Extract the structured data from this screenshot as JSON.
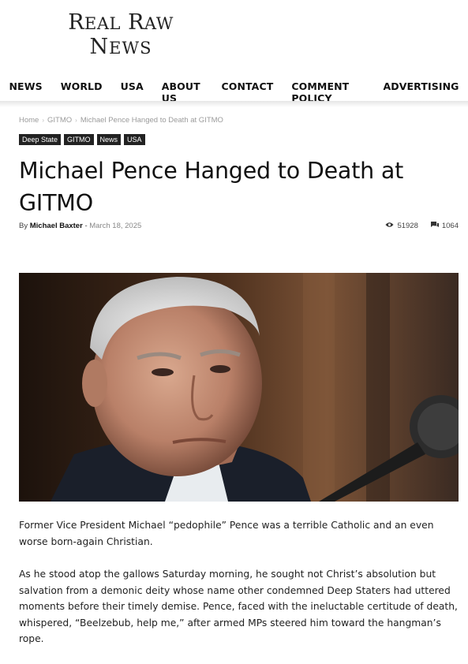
{
  "logo": {
    "line1": "Real Raw",
    "line2": "News"
  },
  "nav": {
    "items": [
      "NEWS",
      "WORLD",
      "USA",
      "ABOUT US",
      "CONTACT",
      "COMMENT POLICY",
      "ADVERTISING"
    ]
  },
  "breadcrumb": {
    "home": "Home",
    "category": "GITMO",
    "current": "Michael Pence Hanged to Death at GITMO"
  },
  "tags": [
    "Deep State",
    "GITMO",
    "News",
    "USA"
  ],
  "article": {
    "title": "Michael Pence Hanged to Death at GITMO",
    "by": "By",
    "author": "Michael Baxter",
    "date_sep": "-",
    "date": "March 18, 2025",
    "views": "51928",
    "comments": "1064",
    "paragraphs": [
      "Former Vice President Michael “pedophile” Pence was a terrible Catholic and an even worse born-again Christian.",
      "As he stood atop the gallows Saturday morning, he sought not Christ’s absolution but salvation from a demonic deity whose name other condemned Deep Staters had uttered moments before their timely demise. Pence, faced with the ineluctable certitude of death, whispered, “Beelzebub, help me,” after armed MPs steered him toward the hangman’s rope."
    ]
  },
  "icons": {
    "views": "eye-icon",
    "comments": "comment-icon",
    "breadcrumb_sep": "chevron-right-icon"
  }
}
